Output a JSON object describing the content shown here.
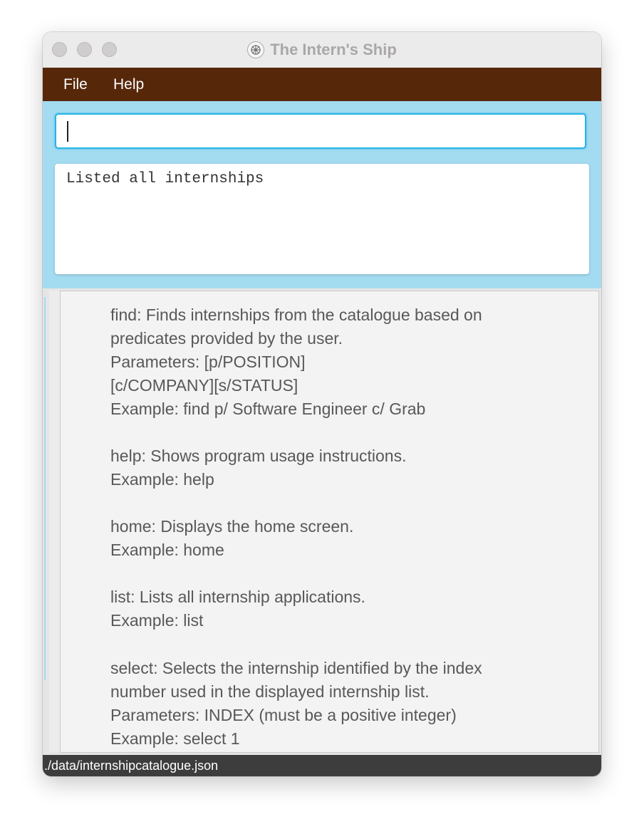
{
  "window": {
    "title": "The Intern's Ship",
    "app_icon": "ship-wheel-icon"
  },
  "menu": {
    "items": [
      {
        "label": "File"
      },
      {
        "label": "Help"
      }
    ]
  },
  "command_box": {
    "value": "",
    "placeholder": ""
  },
  "result_display": {
    "text": "Listed all internships"
  },
  "help_panel": {
    "entries": [
      {
        "text": "find: Finds internships from the catalogue based on\npredicates provided by the user.\nParameters: [p/POSITION]\n[c/COMPANY][s/STATUS]\nExample: find p/ Software Engineer c/ Grab"
      },
      {
        "text": "help: Shows program usage instructions.\nExample: help"
      },
      {
        "text": "home: Displays the home screen.\nExample: home"
      },
      {
        "text": "list: Lists all internship applications.\nExample: list"
      },
      {
        "text": "select: Selects the internship identified by the index\nnumber used in the displayed internship list.\nParameters: INDEX (must be a positive integer)\nExample: select 1"
      }
    ]
  },
  "status_bar": {
    "path": "./data/internshipcatalogue.json"
  },
  "colors": {
    "menubar": "#57270a",
    "accent": "#a3dbf0",
    "statusbar": "#3d3d3d",
    "input_border": "#27b3e4"
  }
}
